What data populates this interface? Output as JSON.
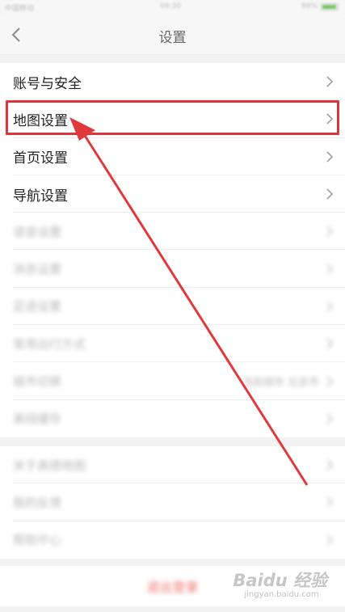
{
  "status_bar": {
    "carrier": "中国移动",
    "time": "09:30",
    "battery": "88%"
  },
  "nav": {
    "title": "设置",
    "back_icon": "chevron-left-icon"
  },
  "settings_group_1": [
    {
      "label": "账号与安全"
    },
    {
      "label": "地图设置"
    },
    {
      "label": "首页设置"
    },
    {
      "label": "导航设置"
    },
    {
      "label": "语音设置"
    },
    {
      "label": "消息设置"
    },
    {
      "label": "足迹设置"
    },
    {
      "label": "常用出行方式"
    },
    {
      "label": "城市切换",
      "value": "当前城市 北京市"
    },
    {
      "label": "离线缓存"
    }
  ],
  "settings_group_2": [
    {
      "label": "关于高德地图"
    },
    {
      "label": "我的反馈"
    },
    {
      "label": "帮助中心"
    }
  ],
  "logout": {
    "label": "退出登录"
  },
  "watermark": {
    "logo": "Baidu 经验",
    "sub": "jingyan.baidu.com"
  },
  "colors": {
    "highlight": "#d9373b",
    "logout": "#e8413b"
  }
}
